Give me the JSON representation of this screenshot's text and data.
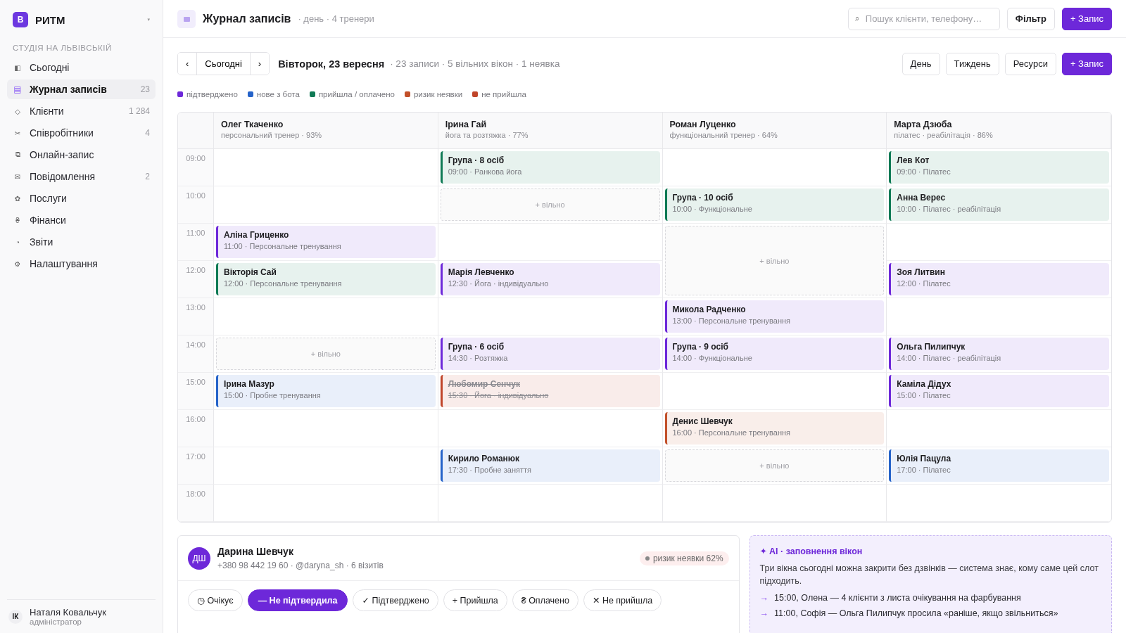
{
  "sidebar": {
    "brand": {
      "logo": "В",
      "name": "РИТМ",
      "caret": "▾"
    },
    "section": "СТУДІЯ НА ЛЬВІВСЬКІЙ",
    "items": [
      {
        "icon": "◧",
        "label": "Сьогодні",
        "selected": false
      },
      {
        "icon": "▤",
        "label": "Журнал записів",
        "count": "23",
        "selected": true
      },
      {
        "icon": "◇",
        "label": "Клієнти",
        "count": "1 284",
        "selected": false
      },
      {
        "icon": "✂",
        "label": "Співробітники",
        "count": "4",
        "selected": false
      },
      {
        "icon": "⧉",
        "label": "Онлайн-запис",
        "selected": false
      },
      {
        "icon": "✉",
        "label": "Повідомлення",
        "count": "2",
        "selected": false
      },
      {
        "icon": "✿",
        "label": "Послуги",
        "selected": false
      },
      {
        "icon": "₴",
        "label": "Фінанси",
        "selected": false
      },
      {
        "icon": "◔",
        "label": "Звіти",
        "selected": false
      },
      {
        "icon": "⚙",
        "label": "Налаштування",
        "selected": false
      }
    ],
    "user": {
      "initials": "ІК",
      "name": "Наталя Ковальчук",
      "role": "адміністратор"
    }
  },
  "header": {
    "title": "Журнал записів",
    "subtitle": "· день · 4 тренери",
    "search": {
      "icon": "⌕",
      "placeholder": "Пошук клієнти, телефону…"
    },
    "buttons": [
      {
        "label": "Фільтр",
        "kind": "plain"
      },
      {
        "label": "+ Запис",
        "kind": "primary"
      }
    ]
  },
  "toolbar": {
    "prev": "‹",
    "today": "Сьогодні",
    "next": "›",
    "date": "Вівторок, 23 вересня",
    "summary": "· 23 записи · 5 вільних вікон · 1 неявка",
    "buttons": [
      {
        "label": "День",
        "kind": "plain"
      },
      {
        "label": "Тиждень",
        "kind": "plain"
      },
      {
        "label": "Ресурси",
        "kind": "plain"
      },
      {
        "label": "+ Запис",
        "kind": "primary"
      }
    ]
  },
  "legend": [
    {
      "label": "підтверджено",
      "color": "#6d28d9"
    },
    {
      "label": "нове з бота",
      "color": "#2563c9"
    },
    {
      "label": "прийшла / оплачено",
      "color": "#0f7a55"
    },
    {
      "label": "ризик неявки",
      "color": "#c2502a"
    },
    {
      "label": "не прийшла",
      "color": "#c0452a"
    }
  ],
  "trainers": [
    {
      "name": "Олег Ткаченко",
      "subtitle": "персональний тренер · 93%"
    },
    {
      "name": "Ірина Гай",
      "subtitle": "йога та розтяжка · 77%"
    },
    {
      "name": "Роман Луценко",
      "subtitle": "функціональний тренер · 64%"
    },
    {
      "name": "Марта Дзюба",
      "subtitle": "пілатес · реабілітація · 86%"
    }
  ],
  "rows": [
    {
      "time": "09:00",
      "cells": [
        {
          "kind": "empty"
        },
        {
          "kind": "booking",
          "color": "#0f7a55",
          "crossed_out": false,
          "name": "Група · 8 осіб",
          "detail": "09:00 · Ранкова йога"
        },
        {
          "kind": "empty"
        },
        {
          "kind": "booking",
          "color": "#0f7a55",
          "crossed_out": false,
          "name": "Лев Кот",
          "detail": "09:00 · Пілатес"
        }
      ]
    },
    {
      "time": "10:00",
      "cells": [
        {
          "kind": "empty"
        },
        {
          "kind": "free",
          "label": "+ вільно"
        },
        {
          "kind": "booking",
          "color": "#0f7a55",
          "crossed_out": false,
          "name": "Група · 10 осіб",
          "detail": "10:00 · Функціональне"
        },
        {
          "kind": "booking",
          "color": "#0f7a55",
          "crossed_out": false,
          "name": "Анна Верес",
          "detail": "10:00 · Пілатес · реабілітація"
        }
      ]
    },
    {
      "time": "11:00",
      "cells": [
        {
          "kind": "booking",
          "color": "#6d28d9",
          "crossed_out": false,
          "name": "Аліна Гриценко",
          "detail": "11:00 · Персональне тренування"
        },
        {
          "kind": "empty"
        },
        {
          "kind": "free",
          "label": "+ вільно"
        },
        {
          "kind": "empty"
        }
      ]
    },
    {
      "time": "12:00",
      "cells": [
        {
          "kind": "booking",
          "color": "#0f7a55",
          "crossed_out": false,
          "name": "Вікторія Сай",
          "detail": "12:00 · Персональне тренування"
        },
        {
          "kind": "booking",
          "color": "#6d28d9",
          "crossed_out": false,
          "name": "Марія Левченко",
          "detail": "12:30 · Йога · індивідуально"
        },
        {
          "kind": "continued"
        },
        {
          "kind": "booking",
          "color": "#6d28d9",
          "crossed_out": false,
          "name": "Зоя Литвин",
          "detail": "12:00 · Пілатес"
        }
      ]
    },
    {
      "time": "13:00",
      "cells": [
        {
          "kind": "empty"
        },
        {
          "kind": "empty"
        },
        {
          "kind": "booking",
          "color": "#6d28d9",
          "crossed_out": false,
          "name": "Микола Радченко",
          "detail": "13:00 · Персональне тренування"
        },
        {
          "kind": "empty"
        }
      ]
    },
    {
      "time": "14:00",
      "cells": [
        {
          "kind": "free",
          "label": "+ вільно"
        },
        {
          "kind": "booking",
          "color": "#6d28d9",
          "crossed_out": false,
          "name": "Група · 6 осіб",
          "detail": "14:30 · Розтяжка"
        },
        {
          "kind": "booking",
          "color": "#6d28d9",
          "crossed_out": false,
          "name": "Група · 9 осіб",
          "detail": "14:00 · Функціональне"
        },
        {
          "kind": "booking",
          "color": "#6d28d9",
          "crossed_out": false,
          "name": "Ольга Пилипчук",
          "detail": "14:00 · Пілатес · реабілітація"
        }
      ]
    },
    {
      "time": "15:00",
      "cells": [
        {
          "kind": "booking",
          "color": "#2563c9",
          "crossed_out": false,
          "name": "Ірина Мазур",
          "detail": "15:00 · Пробне тренування"
        },
        {
          "kind": "booking",
          "color": "#c0452a",
          "crossed_out": true,
          "name": "Любомир Сенчук",
          "detail": "15:30 · Йога · індивідуально"
        },
        {
          "kind": "empty"
        },
        {
          "kind": "booking",
          "color": "#6d28d9",
          "crossed_out": false,
          "name": "Каміла Дідух",
          "detail": "15:00 · Пілатес"
        }
      ]
    },
    {
      "time": "16:00",
      "cells": [
        {
          "kind": "empty"
        },
        {
          "kind": "empty"
        },
        {
          "kind": "booking",
          "color": "#c2502a",
          "crossed_out": false,
          "name": "Денис Шевчук",
          "detail": "16:00 · Персональне тренування"
        },
        {
          "kind": "empty"
        }
      ]
    },
    {
      "time": "17:00",
      "cells": [
        {
          "kind": "empty"
        },
        {
          "kind": "booking",
          "color": "#2563c9",
          "crossed_out": false,
          "name": "Кирило Романюк",
          "detail": "17:30 · Пробне заняття"
        },
        {
          "kind": "free",
          "label": "+ вільно"
        },
        {
          "kind": "booking",
          "color": "#2563c9",
          "crossed_out": false,
          "name": "Юлія Пацула",
          "detail": "17:00 · Пілатес"
        }
      ]
    },
    {
      "time": "18:00",
      "cells": [
        {
          "kind": "empty"
        },
        {
          "kind": "empty"
        },
        {
          "kind": "empty"
        },
        {
          "kind": "empty"
        }
      ]
    }
  ],
  "client": {
    "initials": "ДШ",
    "name": "Дарина Шевчук",
    "contact": "+380 98 442 19 60 · @daryna_sh · 6 візитів",
    "risk": "ризик неявки 62%",
    "statuses": [
      {
        "label": "◷ Очікує",
        "selected": false
      },
      {
        "label": "— Не підтвердила",
        "selected": true
      },
      {
        "label": "✓ Підтверджено",
        "selected": false
      },
      {
        "label": "+ Прийшла",
        "selected": false
      },
      {
        "label": "₴ Оплачено",
        "selected": false
      },
      {
        "label": "✕ Не прийшла",
        "selected": false
      }
    ]
  },
  "ai": {
    "title": "✦ AI · заповнення вікон",
    "text": "Три вікна сьогодні можна закрити без дзвінків — система знає, кому саме цей слот підходить.",
    "items": [
      {
        "marker": "→",
        "text": "15:00, Олена — 4 клієнти з листа очікування на фарбування"
      },
      {
        "marker": "→",
        "text": "11:00, Софія — Ольга Пилипчук просила «раніше, якщо звільниться»"
      }
    ]
  }
}
